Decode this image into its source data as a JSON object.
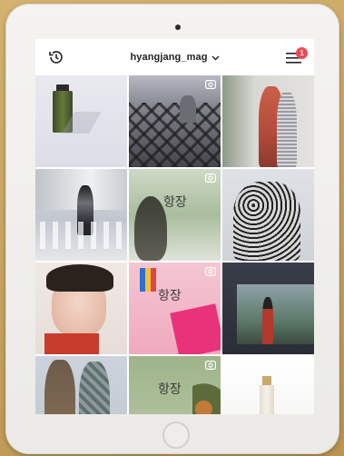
{
  "header": {
    "username": "hyangjang_mag",
    "notification_count": "1"
  },
  "tiles": [
    {
      "label": ""
    },
    {
      "label": ""
    },
    {
      "label": ""
    },
    {
      "label": ""
    },
    {
      "label": "항장"
    },
    {
      "label": ""
    },
    {
      "label": ""
    },
    {
      "label": "항장"
    },
    {
      "label": ""
    },
    {
      "label": ""
    },
    {
      "label": "항장"
    },
    {
      "label": ""
    }
  ],
  "colors": {
    "badge": "#ed4956",
    "background": "#c9a865"
  }
}
